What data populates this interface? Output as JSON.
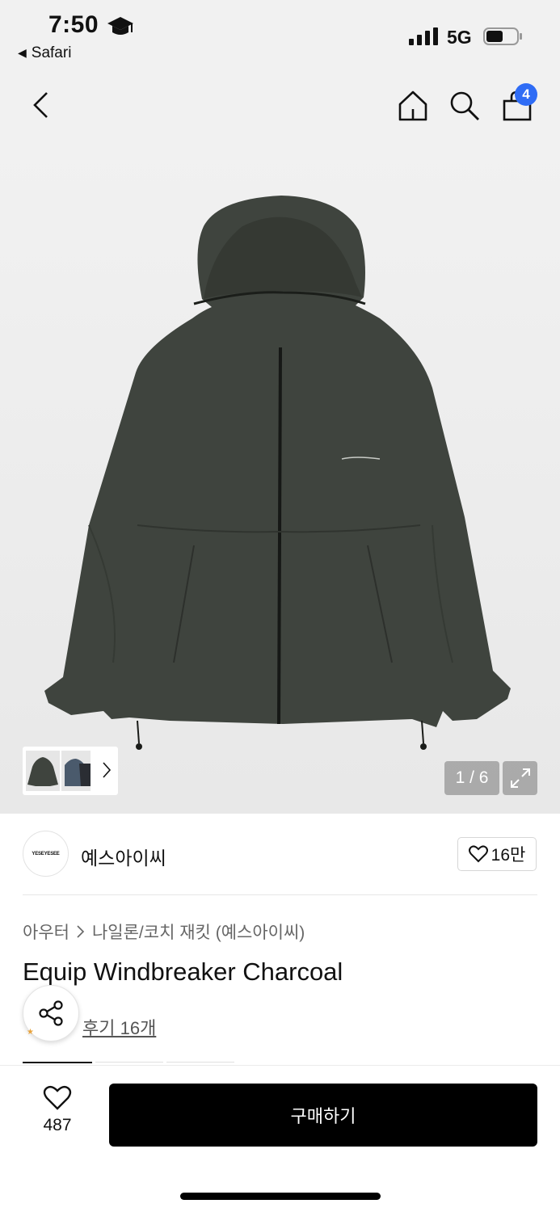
{
  "status_bar": {
    "time": "7:50",
    "back_app": "Safari",
    "network": "5G"
  },
  "nav": {
    "cart_count": "4"
  },
  "gallery": {
    "counter": "1 / 6"
  },
  "brand": {
    "logo_text": "YESEYESEE",
    "name": "예스아이씨",
    "likes": "16만"
  },
  "breadcrumb": {
    "level1": "아우터",
    "level2": "나일론/코치 재킷 (예스아이씨)"
  },
  "product": {
    "title": "Equip Windbreaker Charcoal",
    "review_link": "후기 16개"
  },
  "bottom_bar": {
    "wish_count": "487",
    "buy_label": "구매하기"
  },
  "colors": {
    "accent_blue": "#2f6cf5",
    "jacket": "#3f443e",
    "buy_button": "#000000"
  }
}
